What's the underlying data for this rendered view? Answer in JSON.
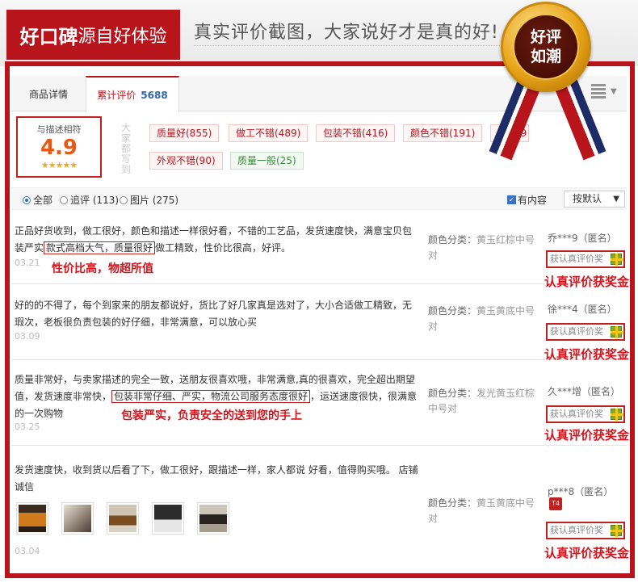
{
  "banner": {
    "title_strong": "好口碑",
    "title_light": "源自好体验",
    "slogan": "真实评价截图，大家说好才是真的好!"
  },
  "medal": {
    "line1": "好评",
    "line2": "如潮"
  },
  "tabs": [
    {
      "label": "商品详情"
    },
    {
      "label": "累计评价",
      "count": "5688"
    }
  ],
  "rating": {
    "label": "与描述相符",
    "score": "4.9",
    "stars": "★★★★★"
  },
  "impressions_label": "大家都写到",
  "tags": [
    {
      "label": "质量好(855)",
      "style": "red"
    },
    {
      "label": "做工不错(489)",
      "style": "red"
    },
    {
      "label": "包装不错(416)",
      "style": "red"
    },
    {
      "label": "颜色不错(191)",
      "style": "red"
    },
    {
      "label": "人气(9",
      "style": "red"
    },
    {
      "label": "外观不错(90)",
      "style": "red"
    },
    {
      "label": "质量一般(25)",
      "style": "green"
    }
  ],
  "filter": {
    "all": "全部",
    "follow_up": "追评 (113)",
    "pictures": "图片 (275)",
    "has_content": "有内容",
    "sort": "按默认"
  },
  "award_label": "获认真评价奖",
  "award_caption": "认真评价获奖金",
  "reviews": [
    {
      "text_before": "正品好货收到，做工很好，颜色和描述一样很好看，不错的工艺品，发货速度快，满意宝贝包装严实",
      "highlight": "款式高档大气，质量很好",
      "text_after": "做工精致，性价比很高，好评。",
      "date": "03.21",
      "note": "性价比高，物超所值",
      "color": "颜色分类：",
      "color_value": "黄玉红棕中号对",
      "user": "乔***9（匿名）"
    },
    {
      "text_before": "好的的不得了，每个到家来的朋友都说好，货比了好几家真是选对了，大小合适做工精致，无瑕次，老板很负责包装的好仔细，非常满意，可以放心买",
      "highlight": "",
      "text_after": "",
      "date": "03.09",
      "note": "",
      "color": "颜色分类：",
      "color_value": "黄玉黄底中号对",
      "user": "徐***4（匿名）"
    },
    {
      "text_before": "质量非常好，与卖家描述的完全一致，送朋友很喜欢哦，非常满意,真的很喜欢，完全超出期望值，发货速度非常快，",
      "highlight": "包装非常仔细、严实，物流公司服务态度很好",
      "text_after": "，运送速度很快，很满意的一次购物",
      "date": "03.25",
      "note": "包装严实，负责安全的送到您的手上",
      "color": "颜色分类：",
      "color_value": "发光黄玉红棕中号对",
      "user": "久***增（匿名）"
    },
    {
      "text_before": "发货速度快，收到货以后看了下，做工很好，跟描述一样，家人都说 好看，值得购买哦。 店铺诚信",
      "highlight": "",
      "text_after": "",
      "date": "03.04",
      "note": "",
      "color": "颜色分类：",
      "color_value": "黄玉黄底中号对",
      "user": "p***8（匿名）",
      "badge": "T4"
    }
  ],
  "colors": {
    "brand_red": "#b8141c",
    "accent_orange": "#e85a13",
    "link_blue": "#3366aa"
  }
}
